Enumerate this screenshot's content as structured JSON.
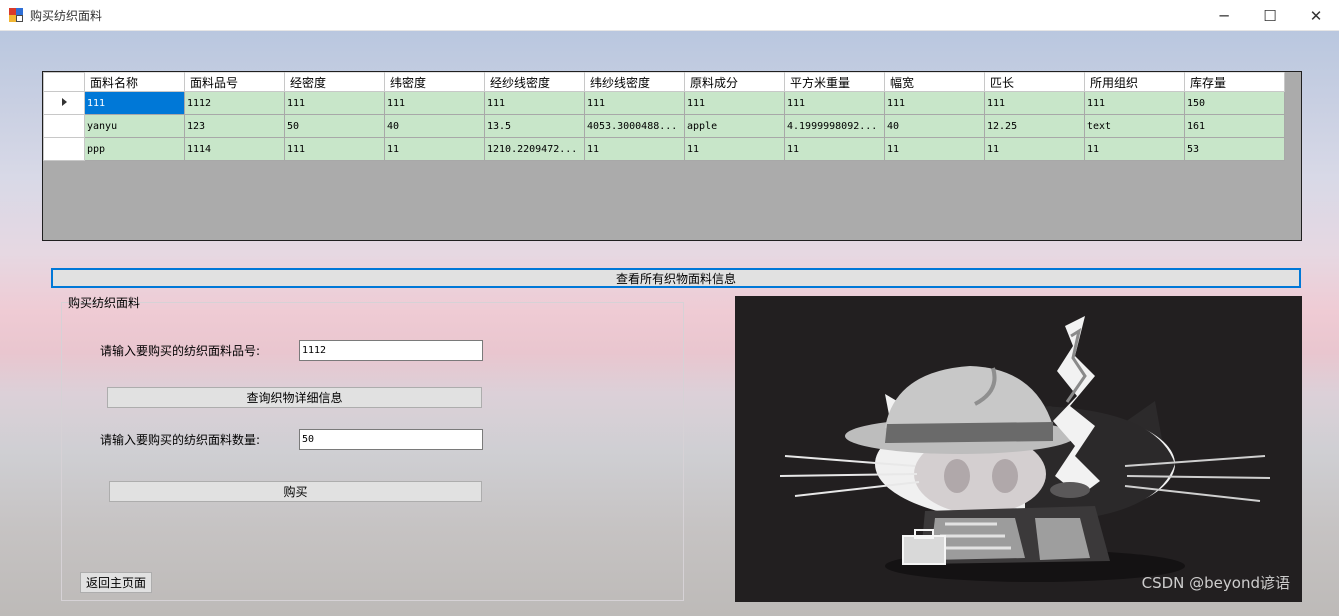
{
  "window": {
    "title": "购买纺织面料",
    "minimize_glyph": "─",
    "maximize_glyph": "☐",
    "close_glyph": "✕"
  },
  "grid": {
    "columns": [
      "面料名称",
      "面料品号",
      "经密度",
      "纬密度",
      "经纱线密度",
      "纬纱线密度",
      "原料成分",
      "平方米重量",
      "幅宽",
      "匹长",
      "所用组织",
      "库存量"
    ],
    "rows": [
      [
        "111",
        "1112",
        "111",
        "111",
        "111",
        "111",
        "111",
        "111",
        "111",
        "111",
        "111",
        "150"
      ],
      [
        "yanyu",
        "123",
        "50",
        "40",
        "13.5",
        "4053.3000488...",
        "apple",
        "4.1999998092...",
        "40",
        "12.25",
        "text",
        "161"
      ],
      [
        "ppp",
        "1114",
        "111",
        "11",
        "1210.2209472...",
        "11",
        "11",
        "11",
        "11",
        "11",
        "11",
        "53"
      ]
    ],
    "selected_row": 0,
    "selected_col": 0
  },
  "view_all_button": "查看所有织物面料信息",
  "purchase_group": {
    "title": "购买纺织面料",
    "code_label": "请输入要购买的纺织面料品号:",
    "code_value": "1112",
    "query_button": "查询织物详细信息",
    "qty_label": "请输入要购买的纺织面料数量:",
    "qty_value": "50",
    "buy_button": "购买",
    "back_button": "返回主页面"
  },
  "picture": {
    "icon": "octocat-detective-icon"
  },
  "watermark": "CSDN @beyond谚语",
  "colors": {
    "grid_bg": "#ababab",
    "cell_green": "#c8e6c9",
    "selection": "#0078d7",
    "button": "#e1e1e1",
    "focus_border": "#0078d7"
  }
}
